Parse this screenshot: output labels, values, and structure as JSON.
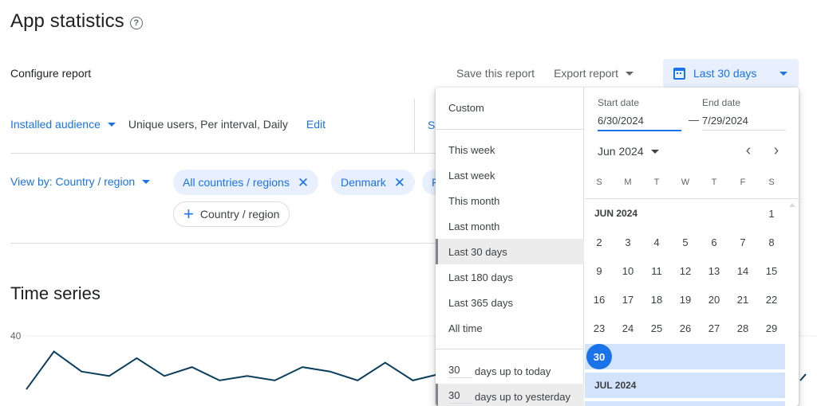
{
  "header": {
    "title": "App statistics",
    "help_icon": "help-circle-icon",
    "configure_label": "Configure report"
  },
  "toolbar": {
    "save_label": "Save this report",
    "export_label": "Export report",
    "date_range_label": "Last 30 days",
    "date_range_icon": "calendar-icon"
  },
  "audience": {
    "selector_label": "Installed audience",
    "description": "Unique users, Per interval, Daily",
    "edit_label": "Edit",
    "truncated_link": "Se"
  },
  "view_by": {
    "label": "View by: Country / region",
    "chips": [
      {
        "label": "All countries / regions"
      },
      {
        "label": "Denmark"
      },
      {
        "label": "F"
      }
    ],
    "add_chip_label": "Country / region"
  },
  "time_series": {
    "title": "Time series"
  },
  "chart_data": {
    "type": "line",
    "title": "Time series",
    "ylabel": "",
    "xlabel": "",
    "y_ticks": [
      "40"
    ],
    "ylim": [
      0,
      40
    ],
    "grid": true,
    "series": [
      {
        "name": "Installed audience",
        "color": "#0b3d5c",
        "values": [
          16,
          33,
          24,
          22,
          30,
          22,
          26,
          20,
          22,
          20,
          26,
          24,
          20,
          28,
          20,
          23
        ]
      }
    ]
  },
  "date_dropdown": {
    "presets": [
      {
        "label": "Custom"
      },
      {
        "label": "This week"
      },
      {
        "label": "Last week"
      },
      {
        "label": "This month"
      },
      {
        "label": "Last month"
      },
      {
        "label": "Last 30 days",
        "selected": true
      },
      {
        "label": "Last 180 days"
      },
      {
        "label": "Last 365 days"
      },
      {
        "label": "All time"
      }
    ],
    "relative": [
      {
        "value": "30",
        "label": "days up to today"
      },
      {
        "value": "30",
        "label": "days up to yesterday",
        "selected": true
      }
    ],
    "start_label": "Start date",
    "start_value": "6/30/2024",
    "end_label": "End date",
    "end_value": "7/29/2024",
    "dash": "—",
    "month_select": "Jun 2024",
    "prev_icon": "chevron-left-icon",
    "next_icon": "chevron-right-icon",
    "weekdays": [
      "S",
      "M",
      "T",
      "W",
      "T",
      "F",
      "S"
    ],
    "months": [
      {
        "label": "JUN 2024",
        "weeks": [
          [
            "",
            "",
            "",
            "",
            "",
            "",
            "1"
          ],
          [
            "2",
            "3",
            "4",
            "5",
            "6",
            "7",
            "8"
          ],
          [
            "9",
            "10",
            "11",
            "12",
            "13",
            "14",
            "15"
          ],
          [
            "16",
            "17",
            "18",
            "19",
            "20",
            "21",
            "22"
          ],
          [
            "23",
            "24",
            "25",
            "26",
            "27",
            "28",
            "29"
          ],
          [
            "30",
            "",
            "",
            "",
            "",
            "",
            ""
          ]
        ]
      },
      {
        "label": "JUL 2024"
      }
    ],
    "selected_day": "30",
    "accent_color": "#1a73e8",
    "range_color": "#d2e3fc"
  }
}
